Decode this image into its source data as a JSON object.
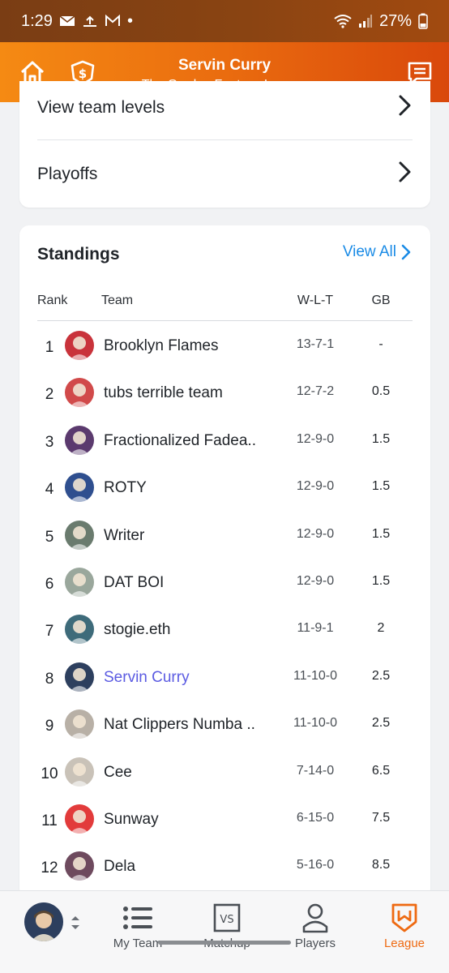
{
  "status_bar": {
    "time": "1:29",
    "dot": "•",
    "battery": "27%",
    "icons": [
      "mail-icon",
      "upload-icon",
      "gmail-icon",
      "wifi-icon",
      "signal-icon",
      "battery-icon"
    ]
  },
  "header": {
    "title": "Servin Curry",
    "subtitle": "The Garden Fantasy League",
    "left_icons": [
      "home-icon",
      "dollar-shield-icon"
    ],
    "right_icon": "chat-icon"
  },
  "menu": {
    "items": [
      {
        "label": "View team levels"
      },
      {
        "label": "Playoffs"
      }
    ]
  },
  "standings": {
    "title": "Standings",
    "view_all": "View All",
    "columns": {
      "rank": "Rank",
      "team": "Team",
      "wlt": "W-L-T",
      "gb": "GB"
    },
    "rows": [
      {
        "rank": "1",
        "team": "Brooklyn Flames",
        "wlt": "13-7-1",
        "gb": "-",
        "avatar_color": "#c9333b"
      },
      {
        "rank": "2",
        "team": "tubs terrible team",
        "wlt": "12-7-2",
        "gb": "0.5",
        "avatar_color": "#d14a4a"
      },
      {
        "rank": "3",
        "team": "Fractionalized Fadea..",
        "wlt": "12-9-0",
        "gb": "1.5",
        "avatar_color": "#5b3a6e"
      },
      {
        "rank": "4",
        "team": "ROTY",
        "wlt": "12-9-0",
        "gb": "1.5",
        "avatar_color": "#2f4f8f"
      },
      {
        "rank": "5",
        "team": "Writer",
        "wlt": "12-9-0",
        "gb": "1.5",
        "avatar_color": "#6a7b6e"
      },
      {
        "rank": "6",
        "team": "DAT BOI",
        "wlt": "12-9-0",
        "gb": "1.5",
        "avatar_color": "#9aa79c"
      },
      {
        "rank": "7",
        "team": "stogie.eth",
        "wlt": "11-9-1",
        "gb": "2",
        "avatar_color": "#3e6b7a"
      },
      {
        "rank": "8",
        "team": "Servin Curry",
        "wlt": "11-10-0",
        "gb": "2.5",
        "avatar_color": "#2d3f5e",
        "is_me": true
      },
      {
        "rank": "9",
        "team": "Nat Clippers Numba ..",
        "wlt": "11-10-0",
        "gb": "2.5",
        "avatar_color": "#b8b0a6"
      },
      {
        "rank": "10",
        "team": "Cee",
        "wlt": "7-14-0",
        "gb": "6.5",
        "avatar_color": "#c9c2b8"
      },
      {
        "rank": "11",
        "team": "Sunway",
        "wlt": "6-15-0",
        "gb": "7.5",
        "avatar_color": "#e23b3b"
      },
      {
        "rank": "12",
        "team": "Dela",
        "wlt": "5-16-0",
        "gb": "8.5",
        "avatar_color": "#6e4a5e"
      }
    ]
  },
  "bottom_nav": {
    "items": [
      {
        "label": "My Team",
        "icon": "list-icon"
      },
      {
        "label": "Matchup",
        "icon": "vs-icon",
        "icon_text": "VS"
      },
      {
        "label": "Players",
        "icon": "person-icon"
      },
      {
        "label": "League",
        "icon": "league-shield-icon",
        "active": true
      }
    ]
  },
  "colors": {
    "accent": "#ee6a12",
    "link": "#1a8be6",
    "me": "#5b5be2"
  }
}
